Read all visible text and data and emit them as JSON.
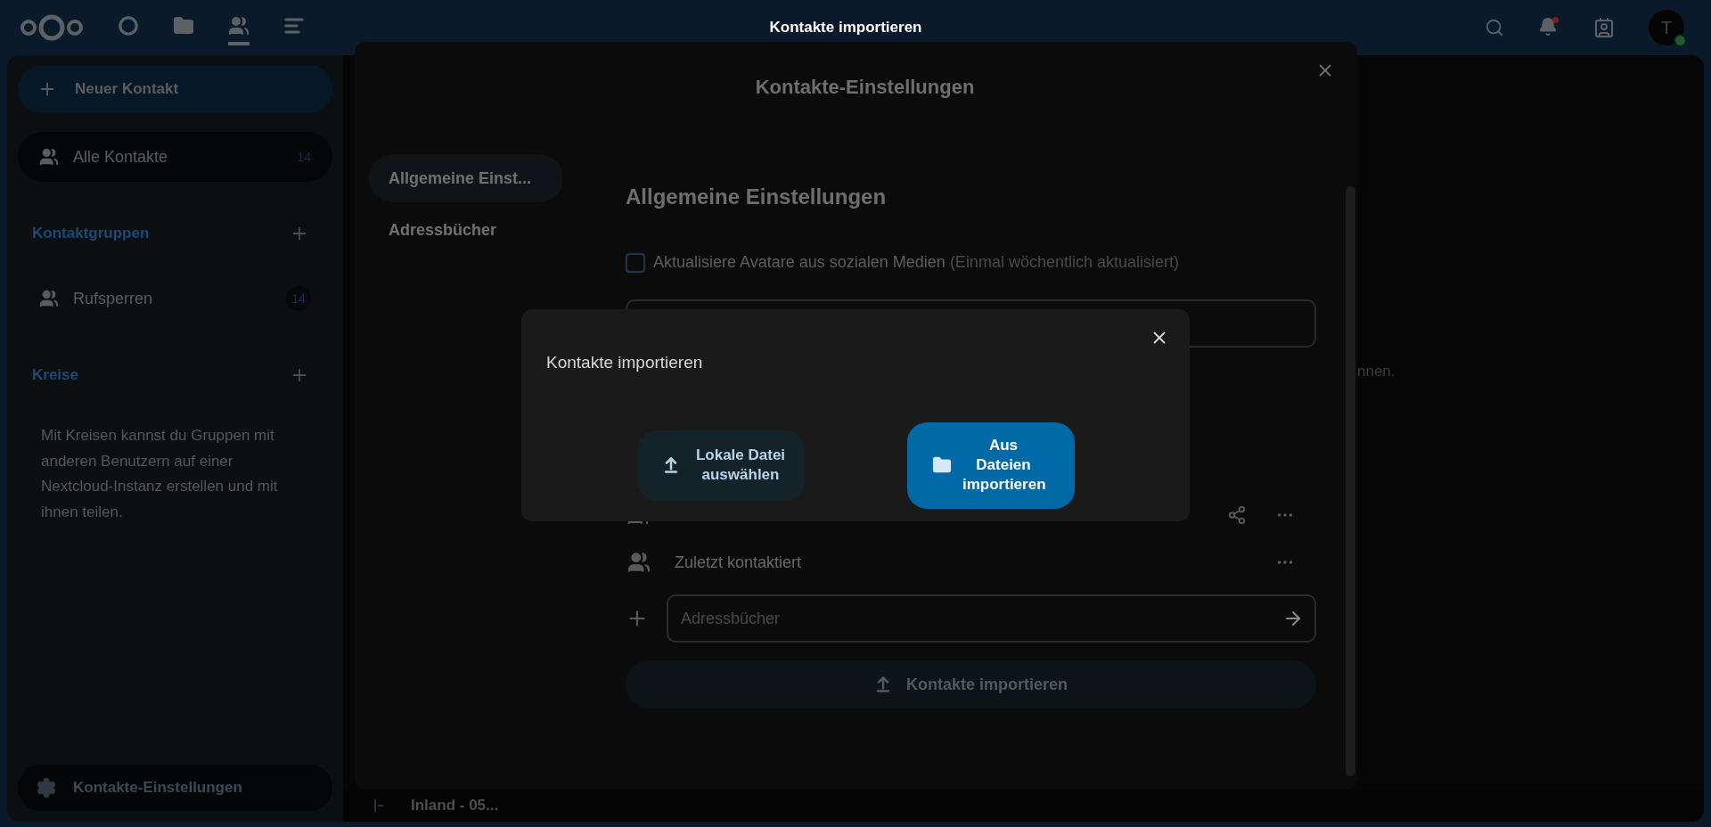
{
  "header": {
    "title": "Kontakte importieren",
    "apps": [
      {
        "kind": "dashboard",
        "selected": false
      },
      {
        "kind": "files",
        "selected": false
      },
      {
        "kind": "contacts",
        "selected": true
      },
      {
        "kind": "activity",
        "selected": false
      }
    ],
    "notifications_unread": true,
    "avatar": {
      "initial": "T",
      "online": true
    }
  },
  "sidebar": {
    "new_contact_button": "Neuer Kontakt",
    "items": [
      {
        "label": "Alle Kontakte",
        "count": "14",
        "selected": true
      }
    ],
    "sections": [
      {
        "title": "Kontaktgruppen",
        "items": [
          {
            "label": "Rufsperren",
            "count": "14",
            "selected": false
          }
        ]
      },
      {
        "title": "Kreise",
        "description": "Mit Kreisen kannst du Gruppen mit anderen Benutzern auf einer Nextcloud-Instanz erstellen und mit ihnen teilen."
      }
    ],
    "settings_button": "Kontakte-Einstellungen"
  },
  "background": {
    "text_fragment": "nnen.",
    "list_item": "Inland - 05..."
  },
  "settings_dialog": {
    "title": "Kontakte-Einstellungen",
    "nav": [
      {
        "label": "Allgemeine Einst...",
        "selected": true
      },
      {
        "label": "Adressbücher",
        "selected": false
      }
    ],
    "section_title": "Allgemeine Einstellungen",
    "checkbox": {
      "label": "Aktualisiere Avatare aus sozialen Medien",
      "hint": "(Einmal wöchentlich aktualisiert)",
      "checked": false
    },
    "addressbooks": [
      {
        "shareable": true
      },
      {
        "label": "Zuletzt kontaktiert",
        "shareable": false
      }
    ],
    "add_field": {
      "placeholder": "Adressbücher"
    },
    "import_button": "Kontakte importieren"
  },
  "import_dialog": {
    "title": "Kontakte importieren",
    "options": [
      {
        "kind": "upload",
        "label": "Lokale Datei auswählen",
        "primary": false
      },
      {
        "kind": "folder",
        "label": "Aus Dateien importieren",
        "primary": true
      }
    ]
  }
}
